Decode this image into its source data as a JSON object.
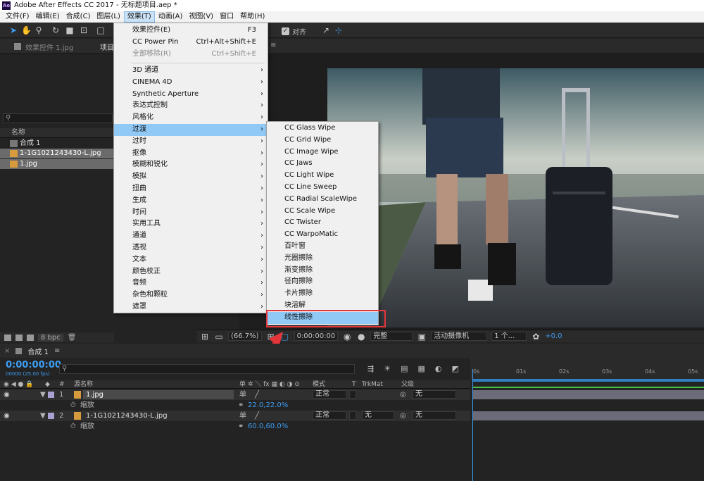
{
  "window": {
    "title": "Adobe After Effects CC 2017 - 无标题项目.aep *",
    "app_icon": "Ae"
  },
  "menubar": [
    "文件(F)",
    "编辑(E)",
    "合成(C)",
    "图层(L)",
    "效果(T)",
    "动画(A)",
    "视图(V)",
    "窗口",
    "帮助(H)"
  ],
  "toolbar": {
    "snap_label": "对齐"
  },
  "panel": {
    "tab_effect_controls": "效果控件 1.jpg",
    "tab_project": "项目",
    "name_col": "名称",
    "items": [
      {
        "label": "合成 1",
        "type": "comp"
      },
      {
        "label": "1-1G1021243430-L.jpg",
        "type": "image"
      },
      {
        "label": "1.jpg",
        "type": "image"
      }
    ],
    "bpc": "8 bpc"
  },
  "effect_menu": {
    "top_items": [
      {
        "label": "效果控件(E)",
        "shortcut": "F3"
      },
      {
        "label": "CC Power Pin",
        "shortcut": "Ctrl+Alt+Shift+E"
      },
      {
        "label": "全部移除(R)",
        "shortcut": "Ctrl+Shift+E",
        "disabled": true
      }
    ],
    "categories": [
      "3D 通道",
      "CINEMA 4D",
      "Synthetic Aperture",
      "表达式控制",
      "风格化",
      "过渡",
      "过时",
      "抠像",
      "模糊和锐化",
      "模拟",
      "扭曲",
      "生成",
      "时间",
      "实用工具",
      "通道",
      "透视",
      "文本",
      "颜色校正",
      "音频",
      "杂色和颗粒",
      "遮罩"
    ],
    "highlighted_category": "过渡"
  },
  "transition_submenu": {
    "items": [
      "CC Glass Wipe",
      "CC Grid Wipe",
      "CC Image Wipe",
      "CC Jaws",
      "CC Light Wipe",
      "CC Line Sweep",
      "CC Radial ScaleWipe",
      "CC Scale Wipe",
      "CC Twister",
      "CC WarpoMatic",
      "百叶窗",
      "光圈擦除",
      "渐变擦除",
      "径向擦除",
      "卡片擦除",
      "块溶解",
      "线性擦除"
    ],
    "highlighted": "线性擦除"
  },
  "viewer_footer": {
    "zoom": "(66.7%)",
    "timecode": "0:00:00:00",
    "quality": "完整",
    "camera": "活动摄像机",
    "views": "1 个...",
    "exposure": "+0.0"
  },
  "timeline": {
    "tab": "合成 1",
    "timecode": "0:00:00:00",
    "fps": "00000 (25.00 fps)",
    "columns": {
      "source_name": "源名称",
      "mode": "模式",
      "t": "T",
      "trkmat": "TrkMat",
      "parent": "父级"
    },
    "ruler": [
      "0s",
      "01s",
      "02s",
      "03s",
      "04s",
      "05s"
    ],
    "layers": [
      {
        "num": "1",
        "name": "1.jpg",
        "mode": "正常",
        "trkmat": "",
        "parent": "无",
        "prop": "缩放",
        "value": "22.0,22.0%"
      },
      {
        "num": "2",
        "name": "1-1G1021243430-L.jpg",
        "mode": "正常",
        "trkmat": "无",
        "parent": "无",
        "prop": "缩放",
        "value": "60.0,60.0%"
      }
    ]
  },
  "colors": {
    "accent": "#3d9df2",
    "highlight": "#90c8f6",
    "annotation": "#e3353a",
    "label_lavender": "#a9a1d2"
  }
}
